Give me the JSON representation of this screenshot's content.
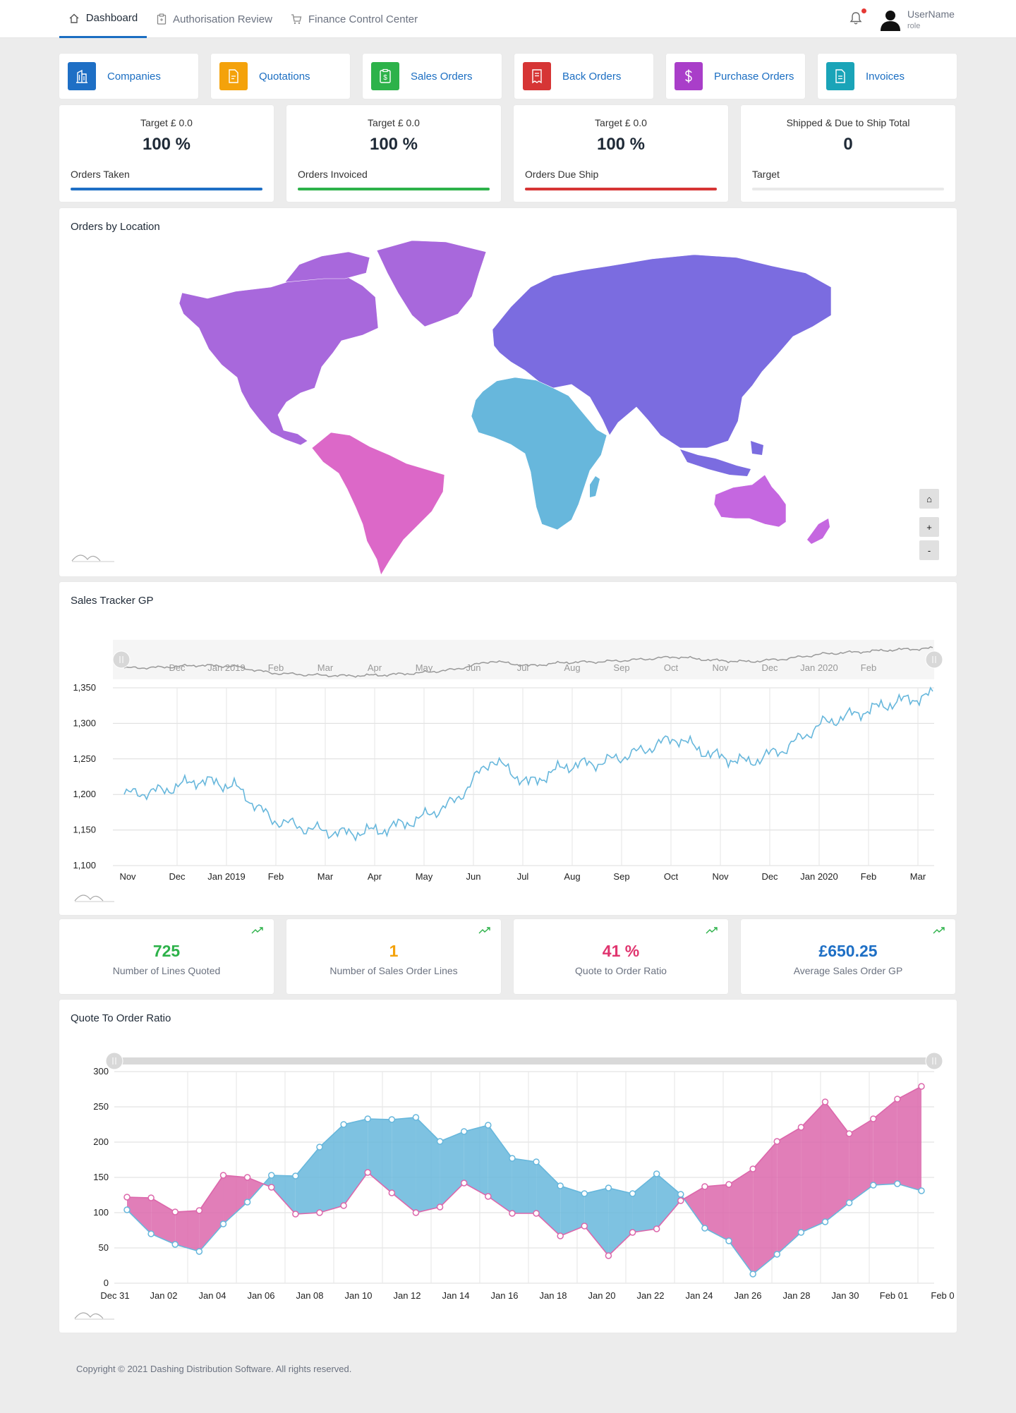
{
  "nav": {
    "items": [
      {
        "label": "Dashboard",
        "icon": "home-icon",
        "active": true
      },
      {
        "label": "Authorisation Review",
        "icon": "clipboard-icon",
        "active": false
      },
      {
        "label": "Finance Control Center",
        "icon": "cart-icon",
        "active": false
      }
    ],
    "user": {
      "name": "UserName",
      "role": "role"
    }
  },
  "quick_links": [
    {
      "label": "Companies",
      "icon": "building-icon",
      "color": "#1e6fc5"
    },
    {
      "label": "Quotations",
      "icon": "document-icon",
      "color": "#f4a20b"
    },
    {
      "label": "Sales Orders",
      "icon": "clipboard-dollar-icon",
      "color": "#2db24a"
    },
    {
      "label": "Back Orders",
      "icon": "receipt-icon",
      "color": "#d63535"
    },
    {
      "label": "Purchase Orders",
      "icon": "dollar-icon",
      "color": "#a93ec9"
    },
    {
      "label": "Invoices",
      "icon": "invoice-icon",
      "color": "#1aa4b8"
    }
  ],
  "stats": [
    {
      "target": "Target £ 0.0",
      "value": "100 %",
      "label": "Orders Taken",
      "color": "#1e6fc5",
      "progress": 1.0
    },
    {
      "target": "Target £ 0.0",
      "value": "100 %",
      "label": "Orders Invoiced",
      "color": "#2db24a",
      "progress": 1.0
    },
    {
      "target": "Target £ 0.0",
      "value": "100 %",
      "label": "Orders Due Ship",
      "color": "#d63535",
      "progress": 1.0
    },
    {
      "target": "Shipped & Due to Ship Total",
      "value": "0",
      "label": "Target",
      "color": "#e9e9e9",
      "progress": 0.0
    }
  ],
  "map": {
    "title": "Orders by Location",
    "colors": {
      "north_america": "#a868dc",
      "south_america": "#dc68c8",
      "europe_asia": "#7b6ce0",
      "africa": "#67b7dc",
      "oceania": "#c567e0"
    },
    "controls": {
      "home": "⌂",
      "zoom_in": "+",
      "zoom_out": "-"
    }
  },
  "kpis": [
    {
      "value": "725",
      "label": "Number of Lines Quoted",
      "color": "#2db24a"
    },
    {
      "value": "1",
      "label": "Number of Sales Order Lines",
      "color": "#f4a20b"
    },
    {
      "value": "41 %",
      "label": "Quote to Order Ratio",
      "color": "#e0356f"
    },
    {
      "value": "£650.25",
      "label": "Average Sales Order GP",
      "color": "#1e6fc5"
    }
  ],
  "chart_data": [
    {
      "type": "line",
      "title": "Sales Tracker GP",
      "x_tick_labels": [
        "Nov",
        "Dec",
        "Jan 2019",
        "Feb",
        "Mar",
        "Apr",
        "May",
        "Jun",
        "Jul",
        "Aug",
        "Sep",
        "Oct",
        "Nov",
        "Dec",
        "Jan 2020",
        "Feb",
        "Mar"
      ],
      "y_ticks": [
        "1,100",
        "1,150",
        "1,200",
        "1,250",
        "1,300",
        "1,350"
      ],
      "ylim": [
        1100,
        1350
      ],
      "color": "#67b7dc",
      "monthly_values": [
        1200,
        1205,
        1220,
        1212,
        1165,
        1152,
        1145,
        1150,
        1165,
        1190,
        1250,
        1215,
        1240,
        1245,
        1260,
        1280,
        1255,
        1245,
        1265,
        1300,
        1315,
        1330,
        1340
      ],
      "scrollbar_tick_labels": [
        "Dec",
        "Jan 2019",
        "Feb",
        "Mar",
        "Apr",
        "May",
        "Jun",
        "Jul",
        "Aug",
        "Sep",
        "Oct",
        "Nov",
        "Dec",
        "Jan 2020",
        "Feb"
      ],
      "grid": true
    },
    {
      "type": "line",
      "title": "Quote To Order Ratio",
      "x_tick_labels": [
        "Dec 31",
        "Jan 02",
        "Jan 04",
        "Jan 06",
        "Jan 08",
        "Jan 10",
        "Jan 12",
        "Jan 14",
        "Jan 16",
        "Jan 18",
        "Jan 20",
        "Jan 22",
        "Jan 24",
        "Jan 26",
        "Jan 28",
        "Jan 30",
        "Feb 01",
        "Feb 0"
      ],
      "y_ticks": [
        "0",
        "50",
        "100",
        "150",
        "200",
        "250",
        "300"
      ],
      "ylim": [
        0,
        300
      ],
      "series": [
        {
          "color": "#67b7dc",
          "values": [
            104,
            70,
            55,
            45,
            84,
            115,
            153,
            152,
            193,
            225,
            233,
            232,
            235,
            201,
            215,
            224,
            177,
            172,
            138,
            127,
            135,
            127,
            155,
            126,
            78,
            60,
            13,
            41,
            72,
            87,
            114,
            139,
            141,
            131
          ]
        },
        {
          "color": "#dc67ab",
          "values": [
            122,
            121,
            101,
            103,
            153,
            150,
            136,
            98,
            100,
            110,
            157,
            128,
            100,
            108,
            142,
            123,
            99,
            99,
            67,
            81,
            39,
            72,
            77,
            117,
            137,
            140,
            162,
            201,
            221,
            257,
            212,
            233,
            261,
            279
          ]
        }
      ],
      "fill_between": true,
      "grid": true
    }
  ],
  "footer": {
    "text": "Copyright © 2021 Dashing Distribution Software. All rights reserved."
  }
}
